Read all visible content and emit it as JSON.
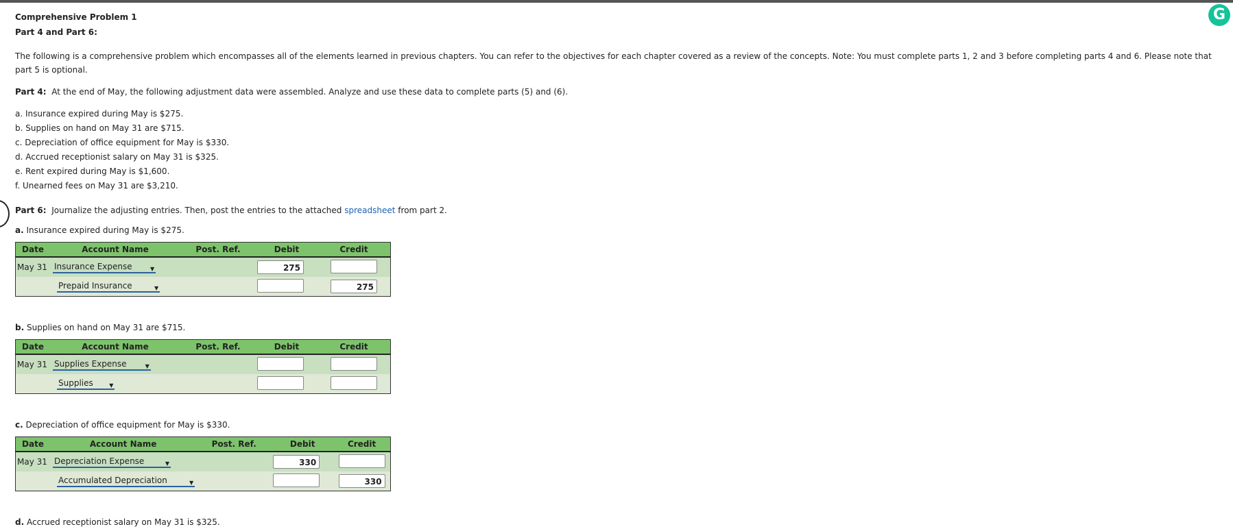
{
  "title": "Comprehensive Problem 1",
  "subtitle": "Part 4 and Part 6:",
  "intro_line1": "The following is a comprehensive problem which encompasses all of the elements learned in previous chapters. You can refer to the objectives for each chapter covered as a review of the concepts. Note: You must complete parts 1, 2 and 3 before completing parts 4 and 6. Please note that",
  "intro_line2": "part 5 is optional.",
  "part4": {
    "label": "Part 4:",
    "text": "At the end of May, the following adjustment data were assembled. Analyze and use these data to complete parts (5) and (6)."
  },
  "adjustments": [
    "a. Insurance expired during May is $275.",
    "b. Supplies on hand on May 31 are $715.",
    "c. Depreciation of office equipment for May is $330.",
    "d. Accrued receptionist salary on May 31 is $325.",
    "e. Rent expired during May is $1,600.",
    "f. Unearned fees on May 31 are $3,210."
  ],
  "part6": {
    "label": "Part 6:",
    "text_before": "Journalize the adjusting entries. Then, post the entries to the attached",
    "link": "spreadsheet",
    "text_after": "from part 2."
  },
  "headers": {
    "date": "Date",
    "account": "Account Name",
    "postref": "Post. Ref.",
    "debit": "Debit",
    "credit": "Credit"
  },
  "entries": [
    {
      "letter": "a.",
      "desc": "Insurance expired during May is $275.",
      "rows": [
        {
          "date": "May 31",
          "account": "Insurance Expense",
          "debit": "275",
          "credit": ""
        },
        {
          "date": "",
          "account": "Prepaid Insurance",
          "debit": "",
          "credit": "275"
        }
      ]
    },
    {
      "letter": "b.",
      "desc": "Supplies on hand on May 31 are $715.",
      "rows": [
        {
          "date": "May 31",
          "account": "Supplies Expense",
          "debit": "",
          "credit": ""
        },
        {
          "date": "",
          "account": "Supplies",
          "debit": "",
          "credit": ""
        }
      ]
    },
    {
      "letter": "c.",
      "desc": "Depreciation of office equipment for May is $330.",
      "rows": [
        {
          "date": "May 31",
          "account": "Depreciation Expense",
          "debit": "330",
          "credit": ""
        },
        {
          "date": "",
          "account": "Accumulated Depreciation",
          "debit": "",
          "credit": "330"
        }
      ]
    },
    {
      "letter": "d.",
      "desc": "Accrued receptionist salary on May 31 is $325.",
      "rows": []
    }
  ],
  "icons": {
    "grammarly": "grammarly-icon",
    "dropdown": "chevron-down-icon"
  },
  "colors": {
    "header_green": "#7dc36b",
    "row1": "#c8dfc0",
    "row2": "#dfe9d6",
    "link": "#1a62b5"
  }
}
